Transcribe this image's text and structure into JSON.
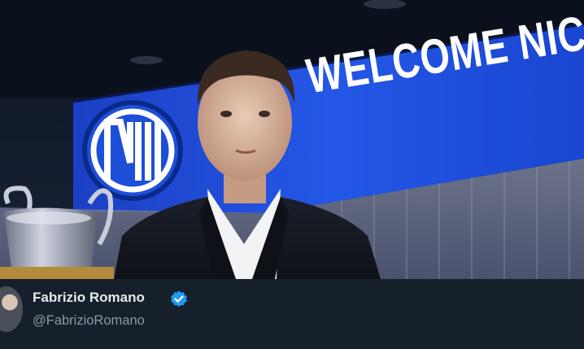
{
  "banner": {
    "welcome_text": "WELCOME NICOLA"
  },
  "author": {
    "name": "Fabrizio Romano",
    "handle": "@FabrizioRomano",
    "verified": true
  },
  "colors": {
    "background": "#15202b",
    "inter_blue": "#1e4fd8",
    "verified_blue": "#1d9bf0",
    "handle_gray": "#8b98a5"
  },
  "icons": [
    "inter-logo-icon",
    "trophy-icon",
    "verified-badge-icon"
  ]
}
